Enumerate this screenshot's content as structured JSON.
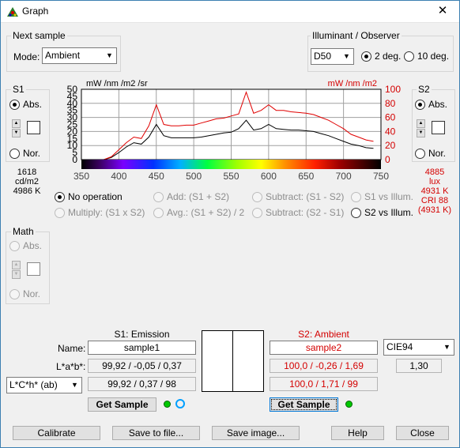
{
  "window": {
    "title": "Graph",
    "close_glyph": "✕"
  },
  "next_sample": {
    "title": "Next sample",
    "mode_label": "Mode:",
    "mode_value": "Ambient"
  },
  "illuminant": {
    "title": "Illuminant / Observer",
    "value": "D50",
    "deg2": "2 deg.",
    "deg10": "10 deg.",
    "selected": "2 deg."
  },
  "s1": {
    "title": "S1",
    "abs": "Abs.",
    "nor": "Nor.",
    "selected": "Abs.",
    "info": [
      "1618",
      "cd/m2",
      "4986 K"
    ]
  },
  "s2": {
    "title": "S2",
    "abs": "Abs.",
    "nor": "Nor.",
    "selected": "Abs.",
    "info": [
      "4885",
      "lux",
      "4931 K",
      "CRI 88",
      "(4931 K)"
    ]
  },
  "math": {
    "title": "Math",
    "abs": "Abs.",
    "nor": "Nor."
  },
  "operations": [
    {
      "label": "No operation",
      "enabled": true,
      "selected": true
    },
    {
      "label": "Add: (S1 + S2)",
      "enabled": false,
      "selected": false
    },
    {
      "label": "Subtract: (S1 - S2)",
      "enabled": false,
      "selected": false
    },
    {
      "label": "S1 vs Illum.",
      "enabled": false,
      "selected": false
    },
    {
      "label": "Multiply: (S1 x S2)",
      "enabled": false,
      "selected": false
    },
    {
      "label": "Avg.: (S1 + S2) / 2",
      "enabled": false,
      "selected": false
    },
    {
      "label": "Subtract: (S2 - S1)",
      "enabled": false,
      "selected": false
    },
    {
      "label": "S2 vs Illum.",
      "enabled": true,
      "selected": false
    }
  ],
  "samples": {
    "s1_header": "S1: Emission",
    "s2_header": "S2: Ambient",
    "name_label": "Name:",
    "lab_label": "L*a*b*:",
    "s1_name": "sample1",
    "s2_name": "sample2",
    "s1_lab": "99,92 / -0,05 / 0,37",
    "s2_lab": "100,0 / -0,26 / 1,69",
    "s1_lch": "99,92 / 0,37 / 98",
    "s2_lch": "100,0 / 1,71 / 99",
    "lch_mode": "L*C*h* (ab)",
    "de_formula": "CIE94",
    "de_value": "1,30",
    "get_sample": "Get Sample"
  },
  "buttons": {
    "calibrate": "Calibrate",
    "save_file": "Save to file...",
    "save_image": "Save image...",
    "help": "Help",
    "close": "Close"
  },
  "chart_data": {
    "type": "line",
    "ylabel_left": "mW /nm /m2 /sr",
    "ylabel_right": "mW /nm /m2",
    "xlim": [
      350,
      750
    ],
    "xticks": [
      350,
      400,
      450,
      500,
      550,
      600,
      650,
      700,
      750
    ],
    "ylim_left": [
      0,
      50
    ],
    "yticks_left": [
      0,
      5,
      10,
      15,
      20,
      25,
      30,
      35,
      40,
      45,
      50
    ],
    "ylim_right": [
      0,
      100
    ],
    "yticks_right": [
      0,
      20,
      40,
      60,
      80,
      100
    ],
    "grid": true,
    "colors": {
      "s1": "#000000",
      "s2": "#e00000"
    },
    "series": [
      {
        "axis": "left",
        "x": [
          380,
          390,
          400,
          410,
          420,
          430,
          440,
          450,
          460,
          470,
          480,
          490,
          500,
          510,
          520,
          530,
          540,
          550,
          560,
          570,
          580,
          590,
          600,
          610,
          620,
          630,
          640,
          650,
          660,
          670,
          680,
          690,
          700,
          710,
          720,
          730,
          740
        ],
        "values": [
          0,
          1.5,
          5,
          9,
          12,
          11,
          16,
          25,
          17,
          15.5,
          15.5,
          15.5,
          15.5,
          16,
          17,
          18,
          19,
          19.5,
          22,
          28,
          21,
          22,
          25,
          22,
          21.5,
          21,
          21,
          20.5,
          20,
          18.5,
          17,
          15,
          13,
          11,
          10,
          8.5,
          8
        ]
      },
      {
        "axis": "right",
        "x": [
          380,
          390,
          400,
          410,
          420,
          430,
          440,
          450,
          460,
          470,
          480,
          490,
          500,
          510,
          520,
          530,
          540,
          550,
          560,
          570,
          580,
          590,
          600,
          610,
          620,
          630,
          640,
          650,
          660,
          670,
          680,
          690,
          700,
          710,
          720,
          730,
          740
        ],
        "values": [
          0,
          4,
          14,
          24,
          32,
          30,
          48,
          78,
          50,
          48,
          48,
          49,
          49,
          52,
          55,
          58,
          59,
          62,
          65,
          96,
          66,
          70,
          78,
          70,
          70,
          68,
          67,
          66,
          64,
          60,
          56,
          50,
          44,
          36,
          32,
          28,
          26
        ]
      }
    ]
  }
}
